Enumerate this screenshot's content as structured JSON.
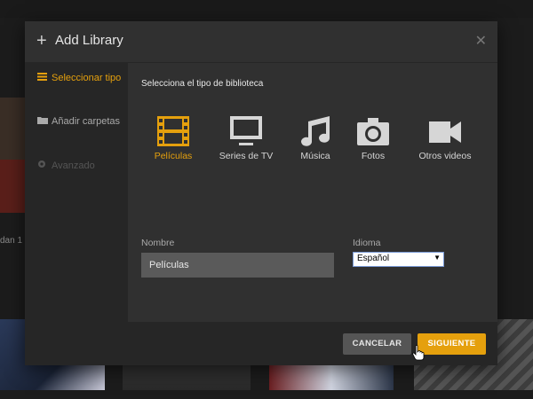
{
  "background": {
    "partial_text": "dan 1 ("
  },
  "dialog": {
    "title": "Add Library",
    "sidebar": {
      "items": [
        {
          "label": "Seleccionar tipo",
          "icon": "stack-icon",
          "state": "active"
        },
        {
          "label": "Añadir carpetas",
          "icon": "folder-icon",
          "state": "normal"
        },
        {
          "label": "Avanzado",
          "icon": "gear-icon",
          "state": "disabled"
        }
      ]
    },
    "section_title": "Selecciona el tipo de biblioteca",
    "types": [
      {
        "label": "Películas",
        "icon": "film-icon",
        "selected": true
      },
      {
        "label": "Series de TV",
        "icon": "tv-icon",
        "selected": false
      },
      {
        "label": "Música",
        "icon": "music-icon",
        "selected": false
      },
      {
        "label": "Fotos",
        "icon": "camera-icon",
        "selected": false
      },
      {
        "label": "Otros videos",
        "icon": "video-camera-icon",
        "selected": false
      }
    ],
    "name_label": "Nombre",
    "name_value": "Películas",
    "language_label": "Idioma",
    "language_value": "Español",
    "cancel_label": "CANCELAR",
    "next_label": "SIGUIENTE"
  },
  "colors": {
    "accent": "#e5a00d",
    "dialog_bg": "#303030",
    "sidebar_bg": "#262626"
  }
}
